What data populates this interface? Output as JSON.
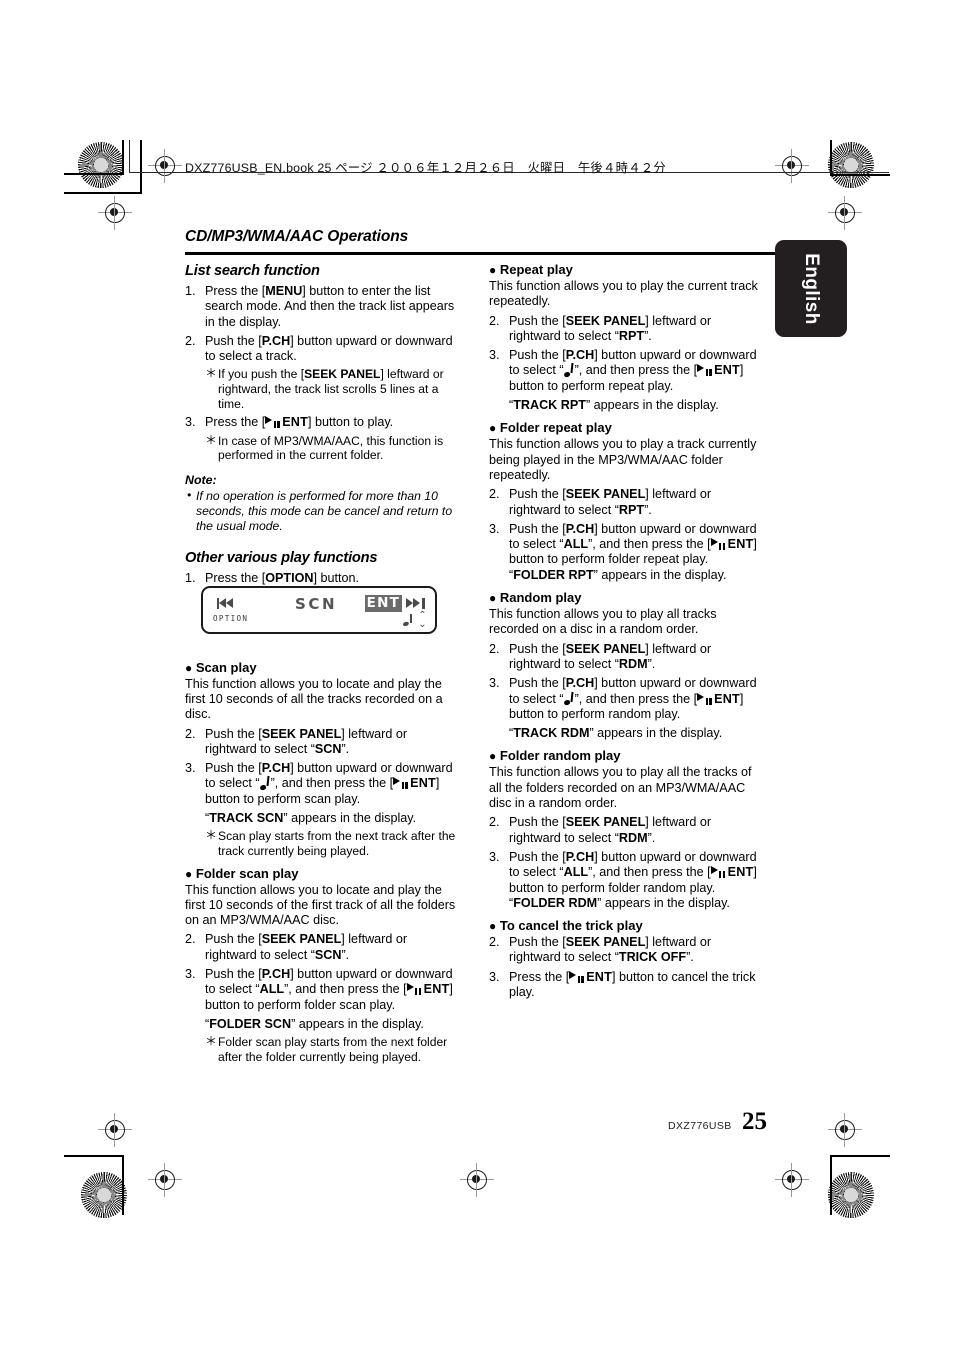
{
  "print_marks": {
    "book_line": "DXZ776USB_EN.book  25 ページ  ２００６年１２月２６日　火曜日　午後４時４２分"
  },
  "chapter": {
    "title": "CD/MP3/WMA/AAC Operations"
  },
  "side_tab": {
    "label": "English"
  },
  "footer": {
    "model": "DXZ776USB",
    "page_number": "25"
  },
  "left_column": {
    "section1_title": "List search function",
    "s1_step1_num": "1.",
    "s1_step1_a": "Press the [",
    "s1_step1_b": "MENU",
    "s1_step1_c": "] button to enter the list search mode. And then the track list appears in the display.",
    "s1_step2_num": "2.",
    "s1_step2_a": "Push the [",
    "s1_step2_b": "P.CH",
    "s1_step2_c": "] button upward or downward to select a track.",
    "s1_step2_sub_a": "If you push the [",
    "s1_step2_sub_b": "SEEK PANEL",
    "s1_step2_sub_c": "] leftward or rightward, the track list scrolls 5 lines at a time.",
    "s1_step3_num": "3.",
    "s1_step3_a": "Press the [",
    "s1_step3_ent": "ENT",
    "s1_step3_c": "] button to play.",
    "s1_step3_sub": "In case of MP3/WMA/AAC, this function is performed in the current folder.",
    "note_heading": "Note:",
    "note_text": "If no operation is performed for more than 10 seconds, this mode can be cancel and return to the usual mode.",
    "section2_title": "Other various play functions",
    "s2_step1_num": "1.",
    "s2_step1_a": "Press the [",
    "s2_step1_b": "OPTION",
    "s2_step1_c": "] button.",
    "lcd_figure": {
      "option_label": "OPTION",
      "scn_label": "SCN",
      "ent_label": "ENT",
      "prev_icon": "skip-backward-icon",
      "next_icon": "skip-forward-icon",
      "note_icon": "music-note-icon",
      "updown_icon": "up-down-chevrons-icon"
    },
    "scan_play": {
      "heading": "Scan play",
      "body": "This function allows you to locate and play the first 10 seconds of all the tracks recorded on a disc.",
      "step2_num": "2.",
      "step2_a": "Push the [",
      "step2_b": "SEEK PANEL",
      "step2_c": "] leftward or rightward to select “",
      "step2_d": "SCN",
      "step2_e": "”.",
      "step3_num": "3.",
      "step3_a": "Push the [",
      "step3_b": "P.CH",
      "step3_c": "] button upward or downward to select “",
      "step3_note": "music-note-icon",
      "step3_d": "”, and then press the [",
      "step3_ent": "ENT",
      "step3_e": "] button to perform scan play.",
      "result_open": "“",
      "result_bold": "TRACK SCN",
      "result_close": "” appears in the display.",
      "sub": "Scan play starts from the next track after the track currently being played."
    },
    "folder_scan_play": {
      "heading": "Folder scan play",
      "body": "This function allows you to locate and play the first 10 seconds of the first track of all the folders on an MP3/WMA/AAC disc.",
      "step2_num": "2.",
      "step2_a": "Push the [",
      "step2_b": "SEEK PANEL",
      "step2_c": "] leftward or rightward to select “",
      "step2_d": "SCN",
      "step2_e": "”.",
      "step3_num": "3.",
      "step3_a": "Push the [",
      "step3_b": "P.CH",
      "step3_c": "] button upward or downward to select “",
      "step3_d": "ALL",
      "step3_e": "”, and then press the [",
      "step3_ent": "ENT",
      "step3_f": "] button to perform folder scan play.",
      "result_open": "“",
      "result_bold": "FOLDER SCN",
      "result_close": "” appears in the display.",
      "sub": "Folder scan play starts from the next folder after the folder currently being played."
    }
  },
  "right_column": {
    "repeat_play": {
      "heading": "Repeat play",
      "body": "This function allows you to play the current track repeatedly.",
      "step2_num": "2.",
      "step2_a": "Push the [",
      "step2_b": "SEEK PANEL",
      "step2_c": "] leftward or rightward to select “",
      "step2_d": "RPT",
      "step2_e": "”.",
      "step3_num": "3.",
      "step3_a": "Push the [",
      "step3_b": "P.CH",
      "step3_c": "] button upward or downward to select “",
      "step3_d": "”, and then press the [",
      "step3_ent": "ENT",
      "step3_e": "] button to perform repeat play.",
      "result_open": "“",
      "result_bold": "TRACK RPT",
      "result_close": "” appears in the display."
    },
    "folder_repeat_play": {
      "heading": "Folder repeat play",
      "body": "This function allows you to play a track currently being played in the MP3/WMA/AAC folder repeatedly.",
      "step2_num": "2.",
      "step2_a": "Push the [",
      "step2_b": "SEEK PANEL",
      "step2_c": "] leftward or rightward to select “",
      "step2_d": "RPT",
      "step2_e": "”.",
      "step3_num": "3.",
      "step3_a": "Push the [",
      "step3_b": "P.CH",
      "step3_c": "] button upward or downward to select “",
      "step3_d": "ALL",
      "step3_e": "”, and then press the [",
      "step3_ent": "ENT",
      "step3_f": "] button to perform folder repeat play. “",
      "step3_result": "FOLDER RPT",
      "step3_g": "” appears in the display."
    },
    "random_play": {
      "heading": "Random play",
      "body": "This function allows you to play all tracks recorded on a disc in a random order.",
      "step2_num": "2.",
      "step2_a": "Push the [",
      "step2_b": "SEEK PANEL",
      "step2_c": "] leftward or rightward to select “",
      "step2_d": "RDM",
      "step2_e": "”.",
      "step3_num": "3.",
      "step3_a": "Push the [",
      "step3_b": "P.CH",
      "step3_c": "] button upward or downward to select “",
      "step3_d": "”, and then press the [",
      "step3_ent": "ENT",
      "step3_e": "] button to perform random play.",
      "result_open": "“",
      "result_bold": "TRACK RDM",
      "result_close": "” appears in the display."
    },
    "folder_random_play": {
      "heading": "Folder random play",
      "body": "This function allows you to play all the tracks of all the folders recorded on an MP3/WMA/AAC disc in a random order.",
      "step2_num": "2.",
      "step2_a": "Push the [",
      "step2_b": "SEEK PANEL",
      "step2_c": "] leftward or rightward to select “",
      "step2_d": "RDM",
      "step2_e": "”.",
      "step3_num": "3.",
      "step3_a": "Push the [",
      "step3_b": "P.CH",
      "step3_c": "] button upward or downward to select “",
      "step3_d": "ALL",
      "step3_e": "”, and then press the [",
      "step3_ent": "ENT",
      "step3_f": "] button to perform folder random play. “",
      "step3_result": "FOLDER RDM",
      "step3_g": "” appears in the display."
    },
    "cancel_trick_play": {
      "heading": "To cancel the trick play",
      "step2_num": "2.",
      "step2_a": "Push the [",
      "step2_b": "SEEK PANEL",
      "step2_c": "] leftward or rightward to select “",
      "step2_d": "TRICK OFF",
      "step2_e": "”.",
      "step3_num": "3.",
      "step3_a": "Press the [",
      "step3_ent": "ENT",
      "step3_b": "] button to cancel the trick play."
    }
  }
}
